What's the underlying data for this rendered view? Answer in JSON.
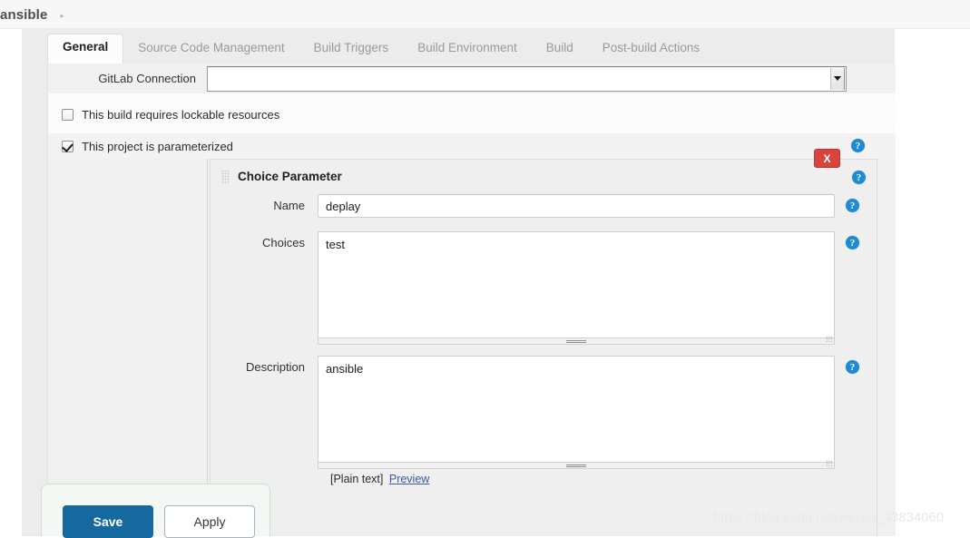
{
  "breadcrumb": {
    "items": [
      "ansible"
    ],
    "separator": "▸"
  },
  "tabs": [
    {
      "label": "General",
      "active": true
    },
    {
      "label": "Source Code Management",
      "active": false
    },
    {
      "label": "Build Triggers",
      "active": false
    },
    {
      "label": "Build Environment",
      "active": false
    },
    {
      "label": "Build",
      "active": false
    },
    {
      "label": "Post-build Actions",
      "active": false
    }
  ],
  "general": {
    "gitlab_connection": {
      "label": "GitLab Connection",
      "value": "",
      "options": [
        ""
      ]
    },
    "lockable_resources": {
      "label": "This build requires lockable resources",
      "checked": false
    },
    "parameterized": {
      "label": "This project is parameterized",
      "checked": true,
      "help_icon": "help-icon"
    }
  },
  "parameter_block": {
    "title": "Choice Parameter",
    "drag_handle_icon": "drag-grip-icon",
    "close_label": "X",
    "help_icon": "help-icon",
    "fields": {
      "name": {
        "label": "Name",
        "value": "deplay",
        "placeholder": ""
      },
      "choices": {
        "label": "Choices",
        "value": "test",
        "placeholder": ""
      },
      "description": {
        "label": "Description",
        "value": "ansible",
        "placeholder": ""
      }
    },
    "description_note": {
      "markup_label": "[Plain text]",
      "preview_label": "Preview"
    }
  },
  "footer": {
    "save_label": "Save",
    "apply_label": "Apply"
  },
  "watermark": "https://blog.csdn.net/weixin_43834060",
  "colors": {
    "accent_blue": "#15699e",
    "help_blue": "#1d8bd1",
    "danger_red": "#d9453c",
    "link_blue": "#3b5998",
    "save_bar_bg": "#f4f8f4",
    "panel_bg": "#ececec"
  }
}
